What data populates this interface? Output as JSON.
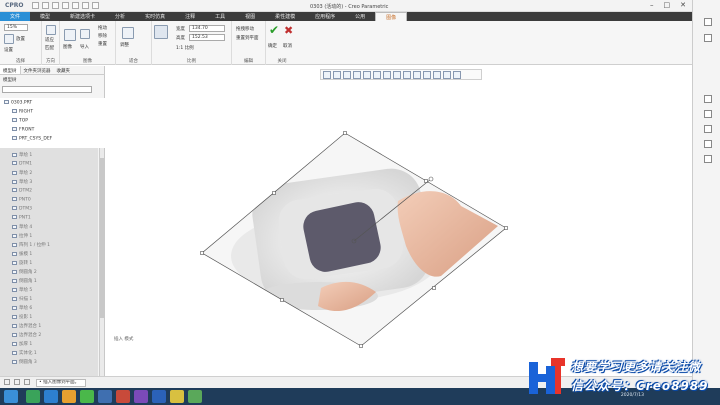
{
  "window": {
    "app_logo": "CPRO",
    "title": "0303 (活动的) - Creo Parametric",
    "controls": [
      "–",
      "□",
      "✕"
    ]
  },
  "menu": {
    "tabs": [
      "文件",
      "模型",
      "新建选项卡",
      "分析",
      "实时仿真",
      "注释",
      "工具",
      "视图",
      "柔性建模",
      "应用程序",
      "公用",
      "图像"
    ]
  },
  "ribbon": {
    "select_label": "选择",
    "opacity_value": "15%",
    "place_label": "放置",
    "set_button": "设置",
    "fit_label": "适应",
    "match_label": "匹配",
    "direction_label": "方向",
    "image_label": "图像",
    "image_btn1": "导入",
    "image_btn2": "拖动",
    "image_btn3": "移除",
    "image_btn4": "重置",
    "adjust_label": "调整",
    "fit_group_label": "适合",
    "width_label": "宽度",
    "width_value": "134.70",
    "height_label": "高度",
    "height_value": "152.53",
    "scale_label": "1:1 比例",
    "ratio_group_label": "比例",
    "edit1": "拖拽移动",
    "edit2": "重置到平面",
    "edit_group_label": "编辑",
    "ok_label": "确定",
    "cancel_label": "取消",
    "close_group_label": "关闭"
  },
  "left_panel": {
    "tabs": [
      "模型树",
      "文件夹浏览器",
      "收藏夹"
    ],
    "toolbar_label": "模型树",
    "top_items": [
      "0303.PRT",
      "RIGHT",
      "TOP",
      "FRONT",
      "PRT_CSYS_DEF"
    ],
    "bottom_items": [
      "草绘 1",
      "DTM1",
      "草绘 2",
      "草绘 3",
      "DTM2",
      "PNT0",
      "DTM3",
      "PNT1",
      "草绘 4",
      "拉伸 1",
      "阵列 1 / 拉伸 1",
      "拔模 1",
      "旋转 1",
      "倒圆角 2",
      "倒圆角 1",
      "草绘 5",
      "扫描 1",
      "草绘 6",
      "投影 1",
      "边界混合 1",
      "边界混合 2",
      "加厚 1",
      "实体化 1",
      "倒圆角 3"
    ]
  },
  "graphics": {
    "view_buttons": 14,
    "note_text": "插入 模式"
  },
  "status": {
    "message": "• 插入图像到平面。"
  },
  "taskbar": {
    "clock": "2020/7/13"
  },
  "watermark": {
    "line1": "想要学习更多请关注微",
    "line2": "信公众号：Creo8989"
  },
  "colors": {
    "menu_bg": "#3c3c3c",
    "file_tab": "#2a8fd6",
    "active_tab_text": "#c7702a",
    "tree_bg": "#e0e0e0",
    "taskbar": "#1f3c5a",
    "watermark_blue": "#0a4aa8"
  }
}
